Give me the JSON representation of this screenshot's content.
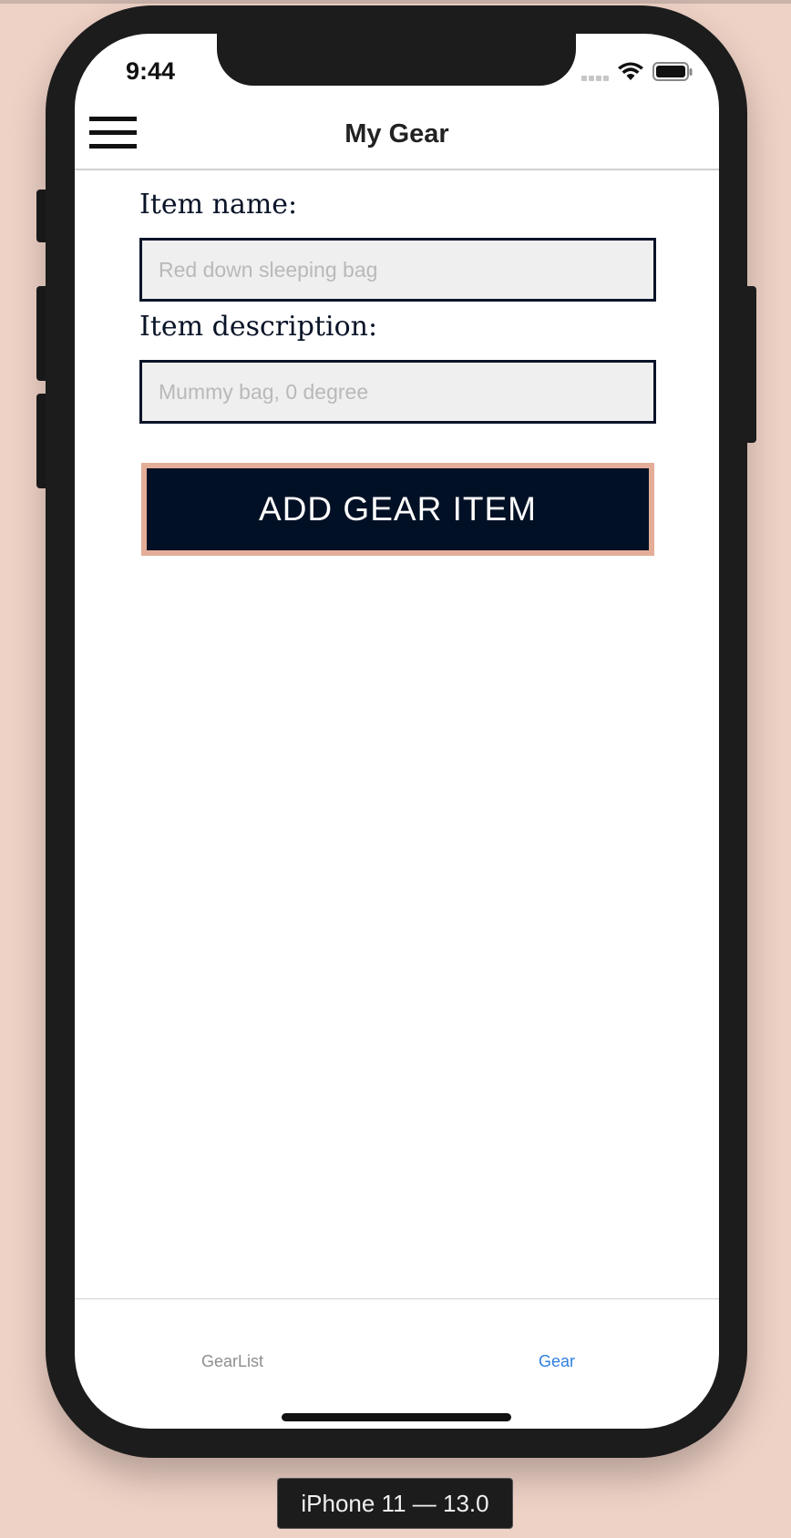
{
  "status_bar": {
    "time": "9:44"
  },
  "header": {
    "title": "My Gear"
  },
  "form": {
    "item_name_label": "Item name:",
    "item_name_placeholder": "Red down sleeping bag",
    "item_name_value": "",
    "item_description_label": "Item description:",
    "item_description_placeholder": "Mummy bag, 0 degree",
    "item_description_value": "",
    "submit_label": "ADD GEAR ITEM"
  },
  "tabs": [
    {
      "label": "GearList",
      "active": false
    },
    {
      "label": "Gear",
      "active": true
    }
  ],
  "device": {
    "label": "iPhone 11 — 13.0"
  },
  "colors": {
    "background": "#efd2c6",
    "navy": "#021025",
    "button_border": "#e4ad98",
    "active_tab": "#2f7fe0",
    "inactive_tab": "#8e8e8e"
  }
}
